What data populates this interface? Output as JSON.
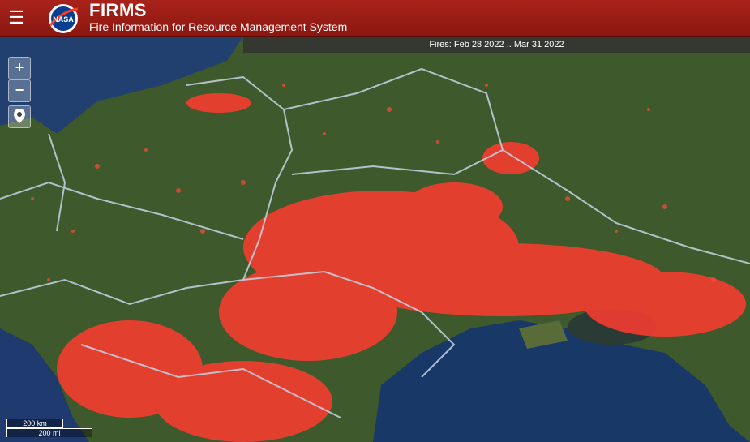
{
  "header": {
    "title": "FIRMS",
    "subtitle": "Fire Information for Resource Management System",
    "logo_text": "NASA"
  },
  "date_range": "Fires: Feb 28 2022 .. Mar 31 2022",
  "controls": {
    "zoom_in": "+",
    "zoom_out": "−"
  },
  "scale": {
    "km": "200 km",
    "mi": "200 mi"
  },
  "colors": {
    "header": "#a8221a",
    "fire": "#ff3b30",
    "water": "#1e3a6e",
    "land": "#3e5a2c",
    "border": "#c8d4e6"
  }
}
